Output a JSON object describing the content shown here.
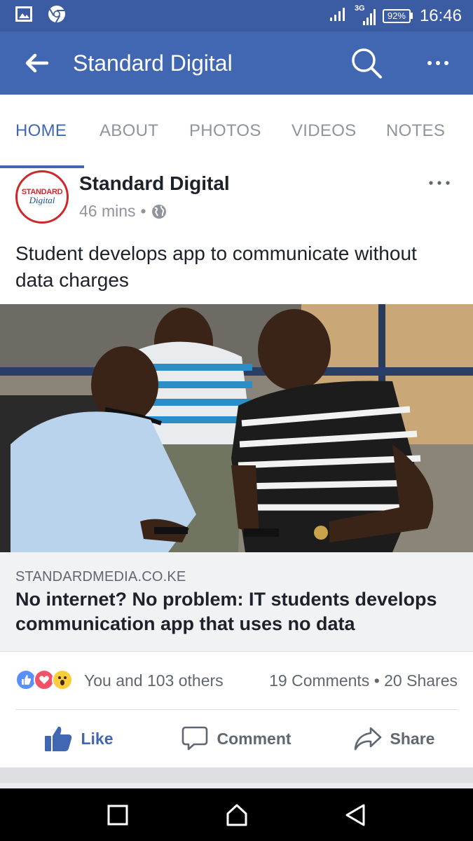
{
  "status_bar": {
    "network_label": "3G",
    "battery": "92%",
    "time": "16:46"
  },
  "app_bar": {
    "title": "Standard Digital"
  },
  "tabs": [
    {
      "label": "HOME",
      "active": true
    },
    {
      "label": "ABOUT",
      "active": false
    },
    {
      "label": "PHOTOS",
      "active": false
    },
    {
      "label": "VIDEOS",
      "active": false
    },
    {
      "label": "NOTES",
      "active": false
    }
  ],
  "post": {
    "avatar_line1": "STANDARD",
    "avatar_line2": "Digital",
    "page_name": "Standard Digital",
    "time": "46 mins",
    "separator": "•",
    "text": "Student develops app to communicate without data charges"
  },
  "link_preview": {
    "domain": "STANDARDMEDIA.CO.KE",
    "title": "No internet? No problem: IT students develops communication app that uses no data"
  },
  "reactions": {
    "icons": [
      "like-reaction-icon",
      "love-reaction-icon",
      "wow-reaction-icon"
    ],
    "summary": "You and 103 others",
    "comments": "19 Comments",
    "separator": "•",
    "shares": "20 Shares"
  },
  "actions": {
    "like": "Like",
    "comment": "Comment",
    "share": "Share"
  },
  "colors": {
    "status_bar": "#3b5ba3",
    "app_bar": "#4267b2",
    "accent": "#4267b2",
    "avatar_border": "#cc2a2a"
  }
}
